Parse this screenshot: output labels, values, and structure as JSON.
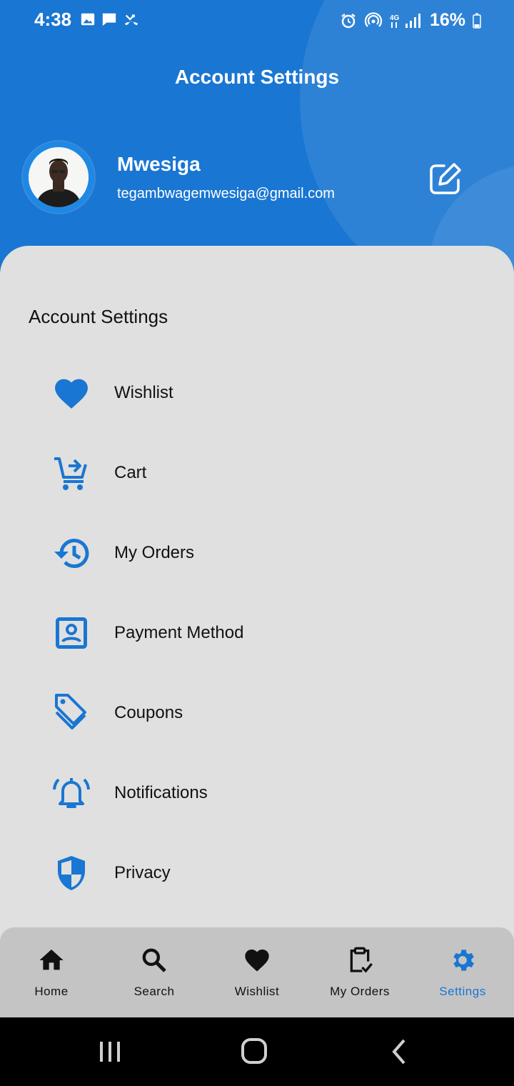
{
  "status_bar": {
    "time": "4:38",
    "battery": "16%"
  },
  "header": {
    "title": "Account Settings",
    "user_name": "Mwesiga",
    "user_email": "tegambwagemwesiga@gmail.com"
  },
  "section": {
    "title": "Account Settings"
  },
  "menu": {
    "items": [
      {
        "label": "Wishlist",
        "icon": "heart-icon"
      },
      {
        "label": "Cart",
        "icon": "cart-icon"
      },
      {
        "label": "My Orders",
        "icon": "history-icon"
      },
      {
        "label": "Payment Method",
        "icon": "account-box-icon"
      },
      {
        "label": "Coupons",
        "icon": "tag-icon"
      },
      {
        "label": "Notifications",
        "icon": "bell-icon"
      },
      {
        "label": "Privacy",
        "icon": "shield-icon"
      }
    ]
  },
  "bottom_nav": {
    "items": [
      {
        "label": "Home",
        "icon": "home-icon"
      },
      {
        "label": "Search",
        "icon": "search-icon"
      },
      {
        "label": "Wishlist",
        "icon": "heart-icon"
      },
      {
        "label": "My Orders",
        "icon": "clipboard-check-icon"
      },
      {
        "label": "Settings",
        "icon": "gear-icon",
        "active": true
      }
    ]
  },
  "colors": {
    "primary": "#1976d2",
    "panel": "#e0e0e0",
    "nav_background": "#c4c4c4"
  }
}
